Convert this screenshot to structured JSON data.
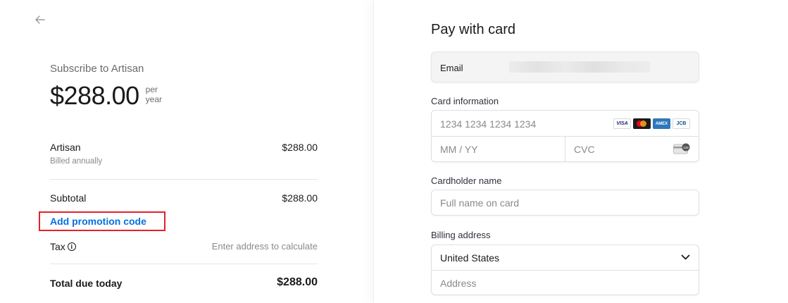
{
  "summary": {
    "subscribe_title": "Subscribe to Artisan",
    "price": "$288.00",
    "period_line1": "per",
    "period_line2": "year",
    "item_name": "Artisan",
    "item_billing": "Billed annually",
    "item_amount": "$288.00",
    "subtotal_label": "Subtotal",
    "subtotal_amount": "$288.00",
    "promo_link": "Add promotion code",
    "tax_label": "Tax",
    "tax_value": "Enter address to calculate",
    "total_label": "Total due today",
    "total_amount": "$288.00"
  },
  "payment": {
    "title": "Pay with card",
    "email_label": "Email",
    "card_info_label": "Card information",
    "card_number_placeholder": "1234 1234 1234 1234",
    "expiry_placeholder": "MM / YY",
    "cvc_placeholder": "CVC",
    "cardholder_label": "Cardholder name",
    "cardholder_placeholder": "Full name on card",
    "billing_label": "Billing address",
    "country_value": "United States",
    "address_placeholder": "Address",
    "brands": {
      "visa": "VISA",
      "amex": "AMEX",
      "jcb": "JCB"
    },
    "cvc_icon_text": "135"
  },
  "colors": {
    "link": "#0570de",
    "highlight_box": "#e3222a"
  }
}
